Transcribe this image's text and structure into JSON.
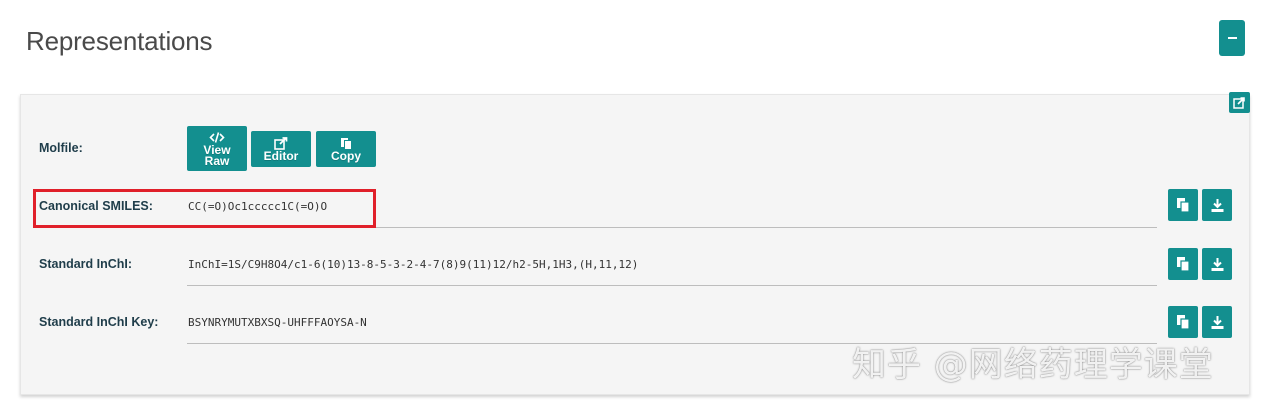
{
  "section": {
    "title": "Representations"
  },
  "molfile": {
    "label": "Molfile:",
    "view_raw_label": [
      "View",
      "Raw"
    ],
    "editor_label": "Editor",
    "copy_label": "Copy"
  },
  "rows": [
    {
      "label": "Canonical SMILES:",
      "value": "CC(=O)Oc1ccccc1C(=O)O"
    },
    {
      "label": "Standard InChI:",
      "value": "InChI=1S/C9H8O4/c1-6(10)13-8-5-3-2-4-7(8)9(11)12/h2-5H,1H3,(H,11,12)"
    },
    {
      "label": "Standard InChI Key:",
      "value": "BSYNRYMUTXBXSQ-UHFFFAOYSA-N"
    }
  ],
  "watermark": "知乎 @网络药理学课堂",
  "colors": {
    "accent": "#138f8f",
    "highlight": "#e0202a",
    "panel_bg": "#f5f5f5"
  },
  "icons": {
    "collapse": "minus-icon",
    "share": "share-icon",
    "view_raw": "code-icon",
    "editor": "external-link-icon",
    "copy": "copy-icon",
    "download": "download-icon"
  }
}
